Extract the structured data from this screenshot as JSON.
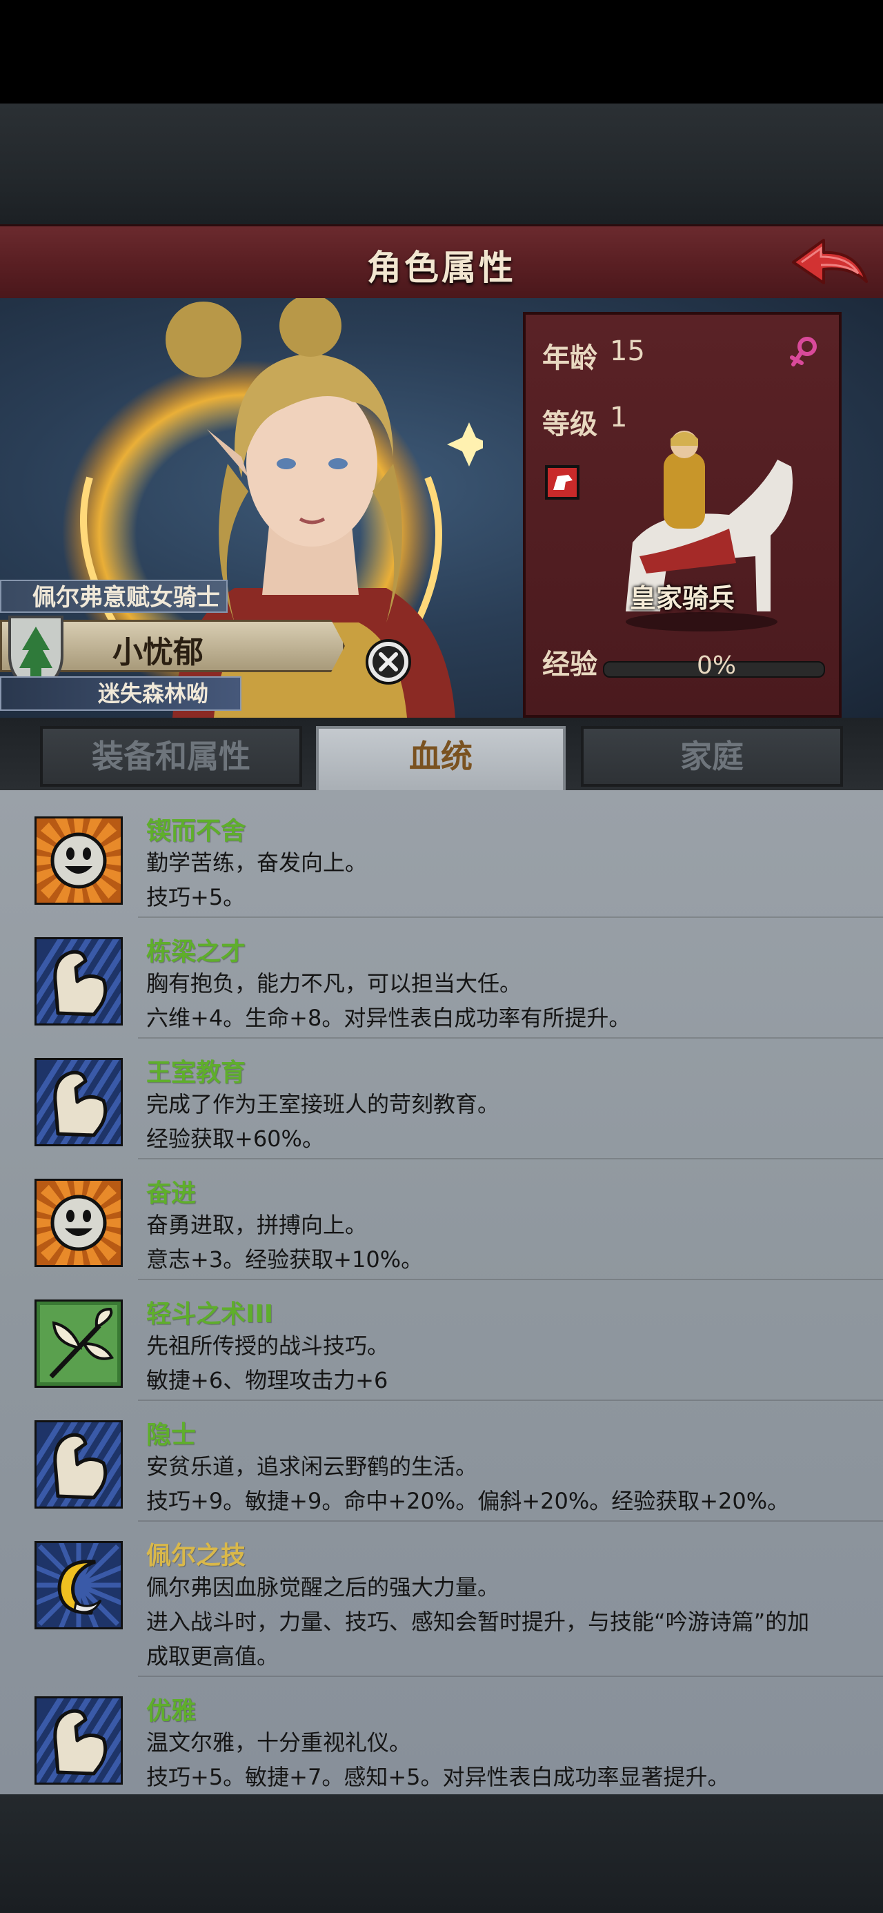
{
  "header": {
    "title": "角色属性",
    "back_icon": "back-arrow-icon"
  },
  "character": {
    "title_tag": "佩尔弗意赋女骑士",
    "name": "小忧郁",
    "subtitle": "迷失森林呦",
    "age_label": "年龄",
    "age": "15",
    "level_label": "等级",
    "level": "1",
    "gender_icon": "female-icon",
    "unit_class": "皇家骑兵",
    "exp_label": "经验",
    "exp_value": "0%",
    "exp_progress": 0
  },
  "tabs": [
    {
      "label": "装备和属性",
      "active": false
    },
    {
      "label": "血统",
      "active": true
    },
    {
      "label": "家庭",
      "active": false
    }
  ],
  "traits": [
    {
      "name": "锲而不舍",
      "icon": "smiley-sun-icon",
      "color": "green",
      "lines": [
        "勤学苦练，奋发向上。",
        "技巧+5。"
      ]
    },
    {
      "name": "栋梁之才",
      "icon": "flexed-arm-icon",
      "color": "green",
      "lines": [
        "胸有抱负，能力不凡，可以担当大任。",
        "六维+4。生命+8。对异性表白成功率有所提升。"
      ]
    },
    {
      "name": "王室教育",
      "icon": "flexed-arm-icon",
      "color": "green",
      "lines": [
        "完成了作为王室接班人的苛刻教育。",
        "经验获取+60%。"
      ]
    },
    {
      "name": "奋进",
      "icon": "smiley-sun-icon",
      "color": "green",
      "lines": [
        "奋勇进取，拼搏向上。",
        "意志+3。经验获取+10%。"
      ]
    },
    {
      "name": "轻斗之术III",
      "icon": "leaf-branch-icon",
      "color": "green",
      "lines": [
        "先祖所传授的战斗技巧。",
        "敏捷+6、物理攻击力+6"
      ]
    },
    {
      "name": "隐士",
      "icon": "flexed-arm-icon",
      "color": "green",
      "lines": [
        "安贫乐道，追求闲云野鹤的生活。",
        "技巧+9。敏捷+9。命中+20%。偏斜+20%。经验获取+20%。"
      ]
    },
    {
      "name": "佩尔之技",
      "icon": "crescent-moon-icon",
      "color": "gold",
      "lines": [
        "佩尔弗因血脉觉醒之后的强大力量。",
        "进入战斗时，力量、技巧、感知会暂时提升，与技能“吟游诗篇”的加",
        "成取更高值。"
      ]
    },
    {
      "name": "优雅",
      "icon": "flexed-arm-icon",
      "color": "green",
      "lines": [
        "温文尔雅，十分重视礼仪。",
        "技巧+5。敏捷+7。感知+5。对异性表白成功率显著提升。"
      ]
    }
  ],
  "colors": {
    "trait_green": "#5fae2c",
    "trait_gold": "#d9b84a",
    "title_bar": "#5a1f23",
    "panel": "#4a1a1e"
  }
}
